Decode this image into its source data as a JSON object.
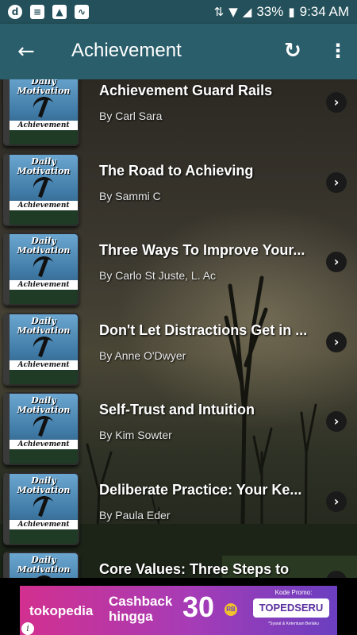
{
  "status_bar": {
    "battery": "33%",
    "time": "9:34 AM"
  },
  "app_bar": {
    "title": "Achievement"
  },
  "thumbnail": {
    "line1": "Daily",
    "line2": "Motivation",
    "band": "Achievement"
  },
  "items": [
    {
      "title": "Achievement Guard Rails",
      "author": "By Carl Sara"
    },
    {
      "title": "The Road to Achieving",
      "author": "By Sammi C"
    },
    {
      "title": "Three Ways To Improve Your...",
      "author": "By Carlo St Juste, L. Ac"
    },
    {
      "title": "Don't Let Distractions Get in ...",
      "author": "By Anne O'Dwyer"
    },
    {
      "title": "Self-Trust and Intuition",
      "author": "By Kim Sowter"
    },
    {
      "title": "Deliberate Practice: Your Ke...",
      "author": "By Paula Eder"
    },
    {
      "title": "Core Values: Three Steps to",
      "author": ""
    }
  ],
  "ad": {
    "brand": "tokopedia",
    "headline_1": "Cashback",
    "headline_2": "hingga",
    "amount": "30",
    "amount_badge": "RB",
    "promo_label": "Kode Promo:",
    "promo_code": "TOPEDSERU",
    "fine_print": "*Syarat & Ketentuan Berlaku",
    "info_icon_glyph": "i"
  },
  "colors": {
    "status_bar": "#23505a",
    "app_bar": "#2a5e6b",
    "ad_gradient_start": "#d2308f",
    "ad_gradient_end": "#6a3fc0"
  }
}
